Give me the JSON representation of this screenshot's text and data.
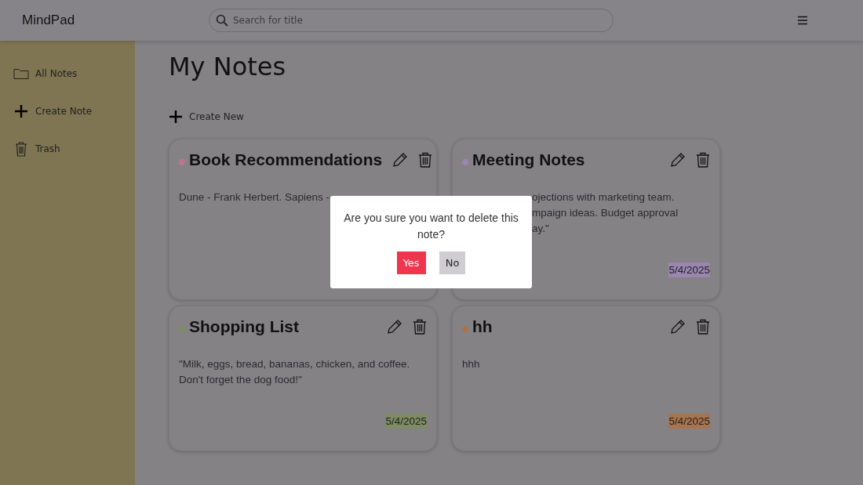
{
  "header": {
    "brand": "MindPad",
    "search": {
      "placeholder": "Search for title"
    }
  },
  "sidebar": {
    "items": [
      {
        "label": "All Notes",
        "kind": "folder"
      },
      {
        "label": "Create Note",
        "kind": "plus"
      },
      {
        "label": "Trash",
        "kind": "trash"
      }
    ]
  },
  "main": {
    "title": "My Notes",
    "create_button": "Create New"
  },
  "notes": [
    {
      "title": "Book Recommendations",
      "color": "#b9788a",
      "body_lines": [
        "Dune - Frank Herbert. Sapiens -"
      ]
    },
    {
      "title": "Meeting Notes",
      "color": "#9a86b0",
      "body_lines": [
        "ojections with marketing team.",
        "mpaign ideas. Budget approval",
        "ay.\""
      ],
      "body_cut": true,
      "date": "5/4/2025"
    },
    {
      "title": "Shopping List",
      "color": "#7d8c62",
      "body_lines": [
        "\"Milk, eggs, bread, bananas, chicken, and coffee.",
        "Don't forget the dog food!\""
      ],
      "date": "5/4/2025"
    },
    {
      "title": "hh",
      "color": "#a8744e",
      "body_lines": [
        "hhh"
      ],
      "date": "5/4/2025"
    }
  ],
  "dialog": {
    "message": "Are you sure you want to delete this note?",
    "confirm": "Yes",
    "cancel": "No"
  }
}
